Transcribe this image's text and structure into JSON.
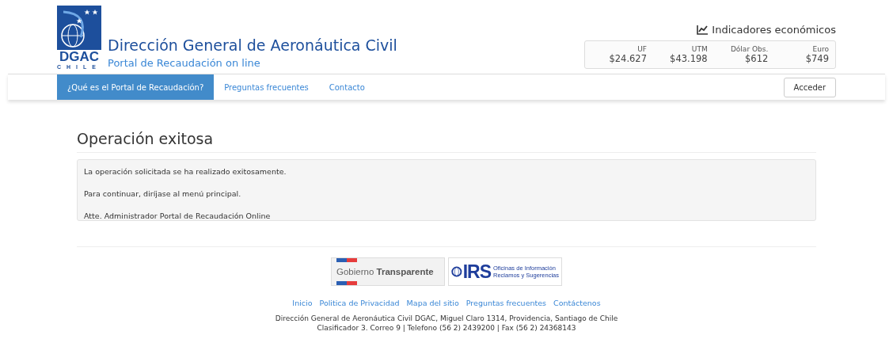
{
  "header": {
    "logo": {
      "acronym": "DGAC",
      "country": "CHILE"
    },
    "title": "Dirección General de Aeronáutica Civil",
    "subtitle": "Portal de Recaudación on line"
  },
  "indicators": {
    "title": "Indicadores económicos",
    "items": [
      {
        "label": "UF",
        "value": "$24.627"
      },
      {
        "label": "UTM",
        "value": "$43.198"
      },
      {
        "label": "Dólar Obs.",
        "value": "$612"
      },
      {
        "label": "Euro",
        "value": "$749"
      }
    ]
  },
  "nav": {
    "items": [
      {
        "label": "¿Qué es el Portal de Recaudación?",
        "selected": true
      },
      {
        "label": "Preguntas frecuentes",
        "selected": false
      },
      {
        "label": "Contacto",
        "selected": false
      }
    ],
    "login_button": "Acceder"
  },
  "page_title": "Operación exitosa",
  "message": [
    "La operación solicitada se ha realizado exitosamente.",
    "Para continuar, diríjase al menú principal.",
    "Atte. Administrador Portal de Recaudación Online"
  ],
  "banners": {
    "gobierno": {
      "light": "Gobierno",
      "bold": "Transparente"
    },
    "oirs": {
      "acronym": "IRS",
      "line_1": "Oficinas de Información",
      "line_2": "Reclamos y Sugerencias"
    }
  },
  "footer": {
    "links": [
      "Inicio",
      "Politica de Privacidad",
      "Mapa del sitio",
      "Preguntas frecuentes",
      "Contáctenos"
    ],
    "address": [
      "Dirección General de Aeronáutica Civil DGAC, Miguel Claro 1314, Providencia, Santiago de Chile",
      "Clasificador 3. Correo 9 | Telefono (56 2) 2439200 | Fax (56 2) 24368143"
    ]
  }
}
